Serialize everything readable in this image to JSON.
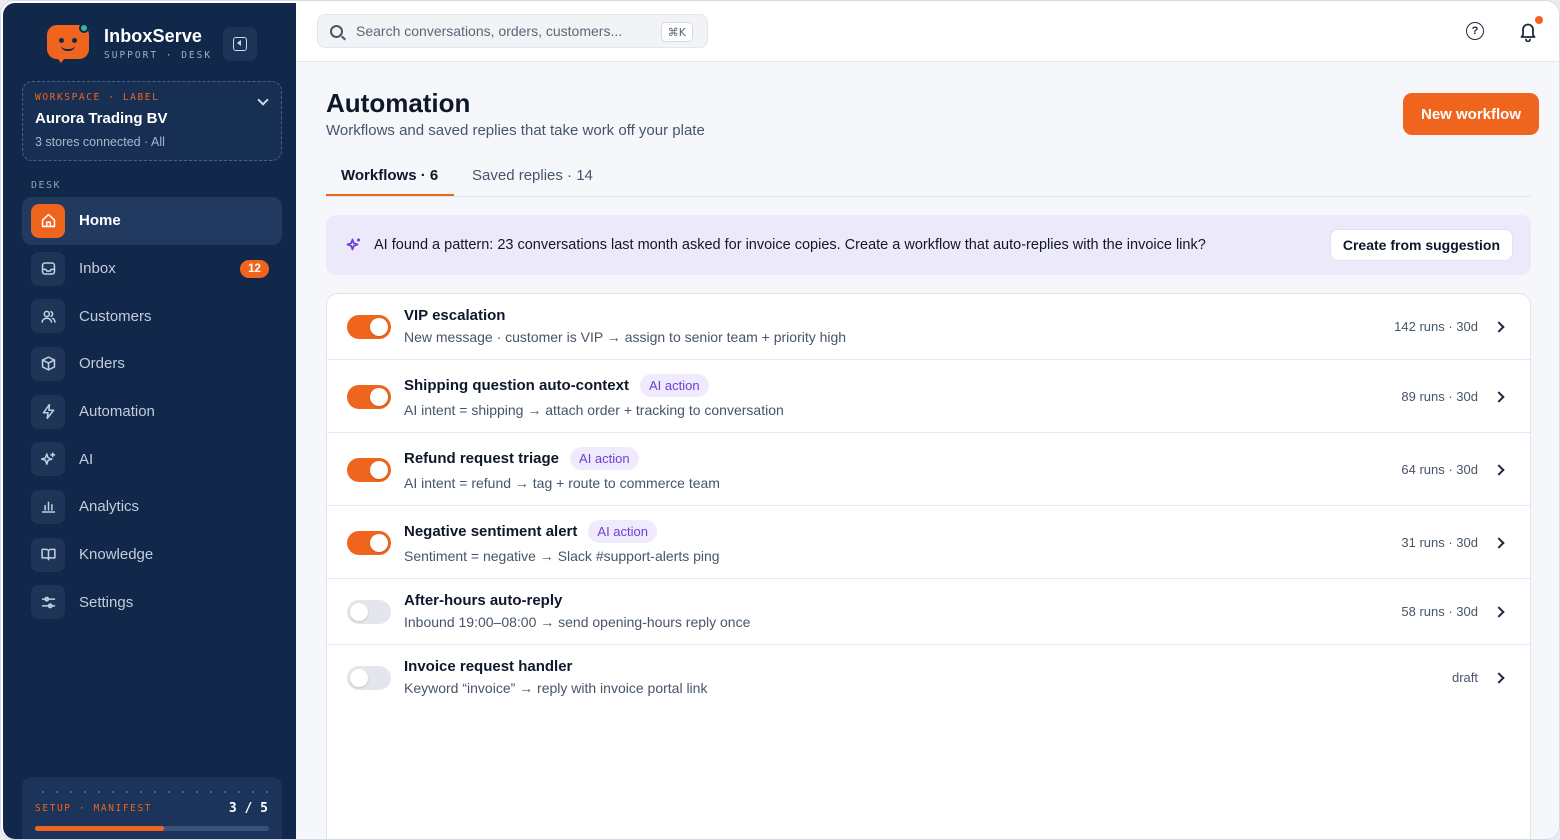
{
  "brand": {
    "name": "InboxServe",
    "sub": "SUPPORT · DESK"
  },
  "workspace": {
    "label": "WORKSPACE · LABEL",
    "name": "Aurora Trading BV",
    "meta": "3 stores connected · All"
  },
  "sidebar": {
    "section": "DESK",
    "items": [
      {
        "label": "Home",
        "icon": "home-icon"
      },
      {
        "label": "Inbox",
        "icon": "inbox-icon",
        "badge": "12"
      },
      {
        "label": "Customers",
        "icon": "customers-icon"
      },
      {
        "label": "Orders",
        "icon": "box-icon"
      },
      {
        "label": "Automation",
        "icon": "bolt-icon"
      },
      {
        "label": "AI",
        "icon": "sparkles-icon"
      },
      {
        "label": "Analytics",
        "icon": "bar-chart-icon"
      },
      {
        "label": "Knowledge",
        "icon": "book-icon"
      },
      {
        "label": "Settings",
        "icon": "sliders-icon"
      }
    ],
    "active": "Home"
  },
  "setup": {
    "label": "SETUP · MANIFEST",
    "count": "3 / 5",
    "progress": 0.55
  },
  "search": {
    "placeholder": "Search conversations, orders, customers...",
    "shortcut": "⌘K"
  },
  "page": {
    "title": "Automation",
    "subtitle": "Workflows and saved replies that take work off your plate",
    "new_button": "New workflow",
    "tabs": [
      {
        "label": "Workflows · 6"
      },
      {
        "label": "Saved replies · 14"
      }
    ],
    "active_tab": 0
  },
  "suggestion": {
    "text": "AI found a pattern: 23 conversations last month asked for invoice copies. Create a workflow that auto-replies with the invoice link?",
    "button": "Create from suggestion"
  },
  "ai_tag_label": "AI action",
  "workflows": [
    {
      "title": "VIP escalation",
      "desc": "New message · customer is VIP → assign to senior team + priority high",
      "runs": "142 runs · 30d",
      "enabled": true,
      "ai": false
    },
    {
      "title": "Shipping question auto-context",
      "desc": "AI intent = shipping → attach order + tracking to conversation",
      "runs": "89 runs · 30d",
      "enabled": true,
      "ai": true
    },
    {
      "title": "Refund request triage",
      "desc": "AI intent = refund → tag + route to commerce team",
      "runs": "64 runs · 30d",
      "enabled": true,
      "ai": true
    },
    {
      "title": "Negative sentiment alert",
      "desc": "Sentiment = negative → Slack #support-alerts ping",
      "runs": "31 runs · 30d",
      "enabled": true,
      "ai": true
    },
    {
      "title": "After-hours auto-reply",
      "desc": "Inbound 19:00–08:00 → send opening-hours reply once",
      "runs": "58 runs · 30d",
      "enabled": false,
      "ai": false
    },
    {
      "title": "Invoice request handler",
      "desc": "Keyword “invoice” → reply with invoice portal link",
      "runs": "draft",
      "enabled": false,
      "ai": false
    }
  ],
  "colors": {
    "accent": "#f0651e",
    "sidebar": "#11284a",
    "ai": "#6d3fd6",
    "ai_bg": "#ece9fb"
  }
}
